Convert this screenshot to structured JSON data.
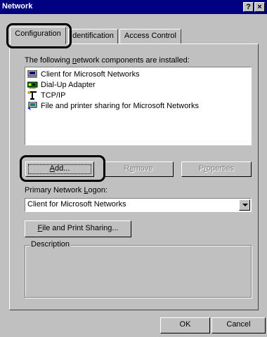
{
  "window": {
    "title": "Network",
    "help_glyph": "?",
    "close_glyph": "×"
  },
  "tabs": [
    {
      "label": "Configuration",
      "active": true
    },
    {
      "label": "dentification",
      "active": false
    },
    {
      "label": "Access Control",
      "active": false
    }
  ],
  "configuration": {
    "installed_label_pre": "The following ",
    "installed_label_u": "n",
    "installed_label_post": "etwork components are installed:",
    "components": [
      {
        "label": "Client for Microsoft Networks",
        "icon": "client-network-icon"
      },
      {
        "label": "Dial-Up Adapter",
        "icon": "network-adapter-icon"
      },
      {
        "label": "TCP/IP",
        "icon": "protocol-icon"
      },
      {
        "label": "File and printer sharing for Microsoft Networks",
        "icon": "service-sharing-icon"
      }
    ],
    "buttons": {
      "add": {
        "pre": "",
        "u": "A",
        "post": "dd..."
      },
      "remove": {
        "pre": "R",
        "u": "e",
        "post": "move"
      },
      "properties": {
        "pre": "P",
        "u": "r",
        "post": "operties"
      }
    },
    "primary_logon_label_pre": "Primary Network ",
    "primary_logon_label_u": "L",
    "primary_logon_label_post": "ogon:",
    "primary_logon_value": "Client for Microsoft Networks",
    "file_print_sharing": {
      "u": "F",
      "post": "ile and Print Sharing..."
    },
    "description_legend": "Description"
  },
  "footer": {
    "ok": "OK",
    "cancel": "Cancel"
  },
  "colors": {
    "titlebar": "#000080",
    "face": "#c0c0c0",
    "highlight_ring": "#000000"
  }
}
